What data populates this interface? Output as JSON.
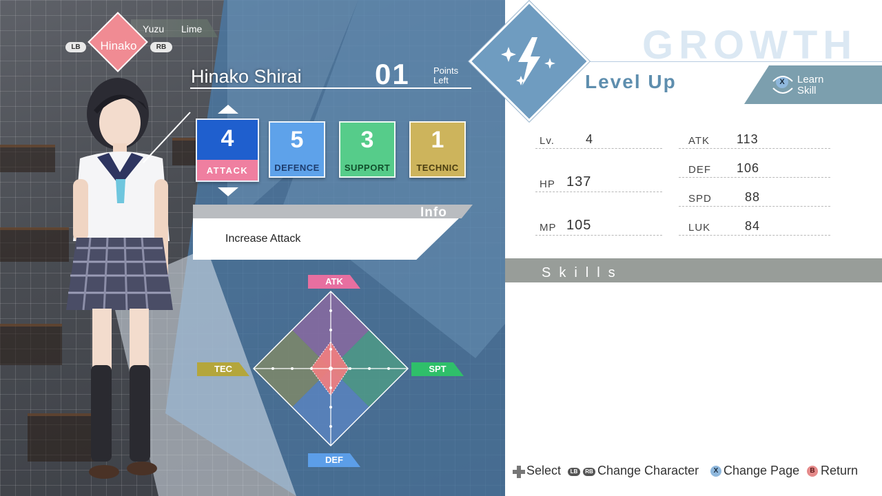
{
  "switcher": {
    "current": "Hinako",
    "others": [
      "Yuzu",
      "Lime"
    ],
    "prev_button": "LB",
    "next_button": "RB"
  },
  "character": {
    "name": "Hinako Shirai",
    "points": "01",
    "points_label_1": "Points",
    "points_label_2": "Left"
  },
  "stats_alloc": [
    {
      "value": "4",
      "label": "ATTACK",
      "color": "#1f5fce",
      "selected": true
    },
    {
      "value": "5",
      "label": "DEFENCE",
      "color": "#5ea2ea"
    },
    {
      "value": "3",
      "label": "SUPPORT",
      "color": "#56cc8a"
    },
    {
      "value": "1",
      "label": "TECHNIC",
      "color": "#cdb45c"
    }
  ],
  "info": {
    "title": "Info",
    "text": "Increase Attack"
  },
  "radar": {
    "axes": {
      "top": "ATK",
      "left": "TEC",
      "right": "SPT",
      "bottom": "DEF"
    },
    "colors": {
      "atk": "#ef7fa0",
      "tec": "#b4a63b",
      "spt": "#2fbf6a",
      "def": "#5c9ee8"
    }
  },
  "growth_title": "GROWTH",
  "level_up": "Level Up",
  "learn_skill": {
    "button": "X",
    "line1": "Learn",
    "line2": "Skill"
  },
  "status": {
    "lv_label": "Lv.",
    "lv": "4",
    "hp_label": "HP",
    "hp": "137",
    "mp_label": "MP",
    "mp": "105",
    "atk_label": "ATK",
    "atk": "113",
    "def_label": "DEF",
    "def": "106",
    "spd_label": "SPD",
    "spd": "88",
    "luk_label": "LUK",
    "luk": "84"
  },
  "skills_header": "Skills",
  "footer": {
    "select": "Select",
    "lb": "LB",
    "rb": "RB",
    "change_character": "Change Character",
    "x": "X",
    "change_page": "Change Page",
    "b": "B",
    "return": "Return"
  }
}
